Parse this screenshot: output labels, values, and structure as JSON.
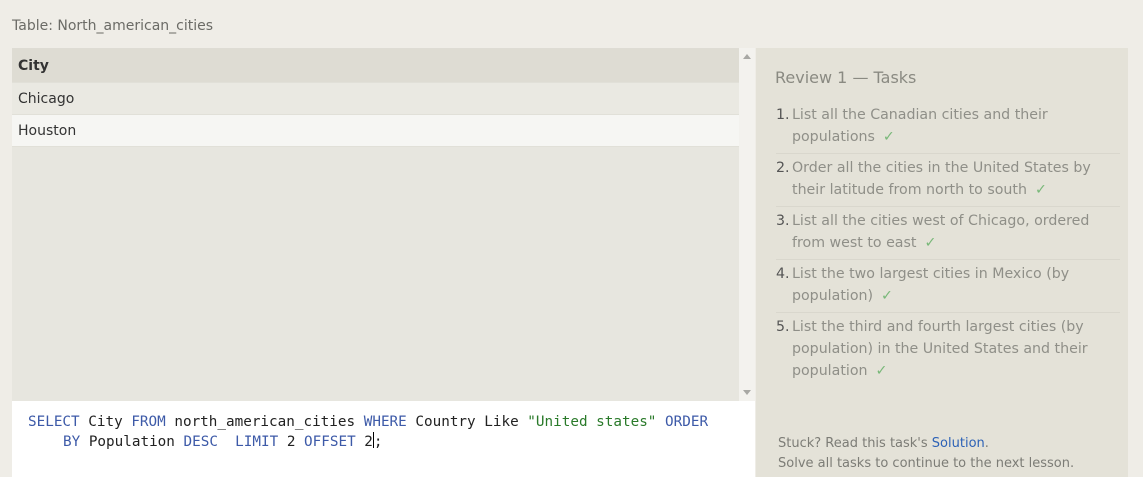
{
  "table_title": "Table: North_american_cities",
  "results": {
    "column": "City",
    "rows": [
      "Chicago",
      "Houston"
    ]
  },
  "editor": {
    "line1": [
      {
        "t": "SELECT",
        "k": "kw"
      },
      {
        "t": " City ",
        "k": ""
      },
      {
        "t": "FROM",
        "k": "kw"
      },
      {
        "t": " north_american_cities ",
        "k": ""
      },
      {
        "t": "WHERE",
        "k": "kw"
      },
      {
        "t": " Country Like ",
        "k": ""
      },
      {
        "t": "\"United states\"",
        "k": "str"
      },
      {
        "t": " ",
        "k": ""
      },
      {
        "t": "ORDER",
        "k": "kw"
      }
    ],
    "line2": [
      {
        "t": "BY",
        "k": "kw"
      },
      {
        "t": " Population ",
        "k": ""
      },
      {
        "t": "DESC",
        "k": "kw"
      },
      {
        "t": "  ",
        "k": ""
      },
      {
        "t": "LIMIT",
        "k": "kw"
      },
      {
        "t": " 2 ",
        "k": ""
      },
      {
        "t": "OFFSET",
        "k": "kw"
      },
      {
        "t": " 2",
        "k": ""
      },
      {
        "t": ";",
        "k": "",
        "caret_before": true
      }
    ]
  },
  "panel": {
    "title": "Review 1 — Tasks",
    "check_glyph": "✓",
    "tasks": [
      {
        "num": "1.",
        "text": "List all the Canadian cities and their populations"
      },
      {
        "num": "2.",
        "text": "Order all the cities in the United States by their latitude from north to south"
      },
      {
        "num": "3.",
        "text": "List all the cities west of Chicago, ordered from west to east"
      },
      {
        "num": "4.",
        "text": "List the two largest cities in Mexico (by population)"
      },
      {
        "num": "5.",
        "text": "List the third and fourth largest cities (by population) in the United States and their population"
      }
    ],
    "footer": {
      "prefix": "Stuck? Read this task's ",
      "link": "Solution",
      "suffix": ".",
      "line2": "Solve all tasks to continue to the next lesson."
    }
  },
  "colors": {
    "keyword": "#3d5aa8",
    "string": "#2a7a2a",
    "check": "#79b879",
    "link": "#2d62b6"
  }
}
